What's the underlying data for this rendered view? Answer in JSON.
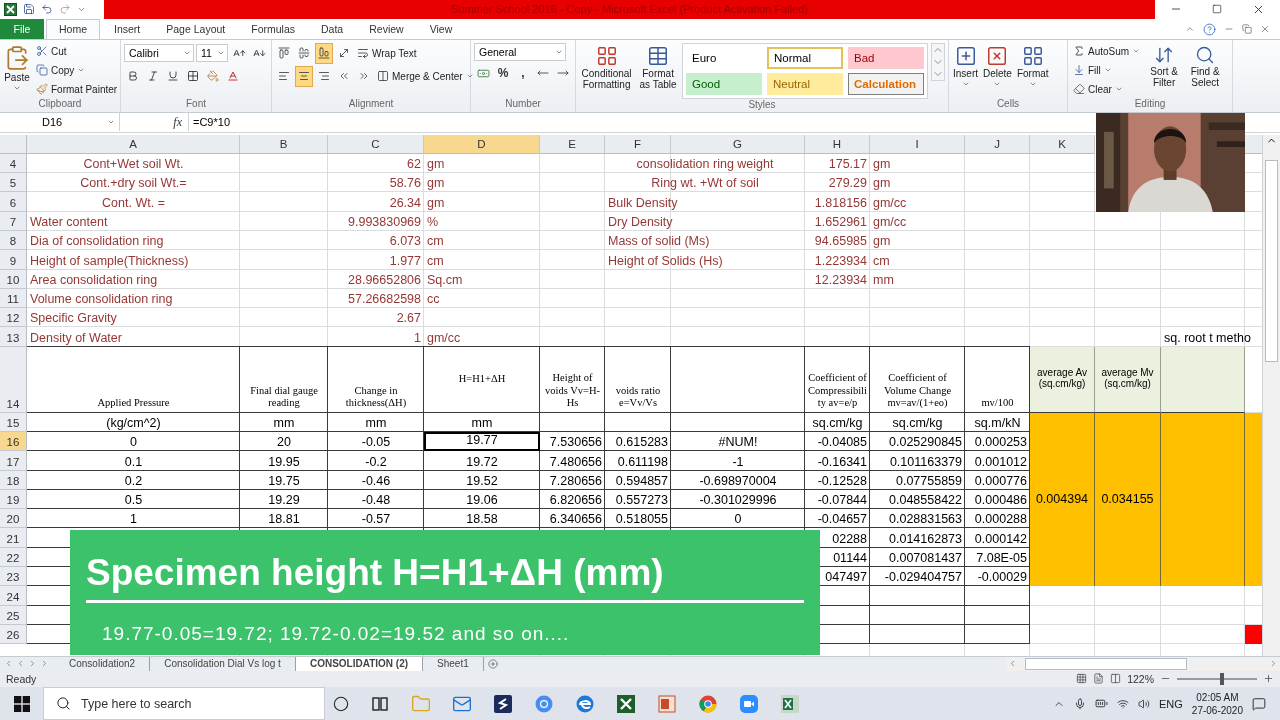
{
  "title": "Summer School 2016 - Copy - Microsoft Excel (Product Activation Failed)",
  "menu_tabs": [
    {
      "label": "File",
      "kind": "file",
      "selected": false
    },
    {
      "label": "Home",
      "kind": "tab",
      "selected": true
    },
    {
      "label": "Insert",
      "kind": "tab",
      "selected": false
    },
    {
      "label": "Page Layout",
      "kind": "tab",
      "selected": false
    },
    {
      "label": "Formulas",
      "kind": "tab",
      "selected": false
    },
    {
      "label": "Data",
      "kind": "tab",
      "selected": false
    },
    {
      "label": "Review",
      "kind": "tab",
      "selected": false
    },
    {
      "label": "View",
      "kind": "tab",
      "selected": false
    }
  ],
  "ribbon": {
    "clipboard": {
      "label": "Clipboard",
      "paste": "Paste",
      "cut": "Cut",
      "copy": "Copy",
      "format_painter": "Format Painter"
    },
    "font": {
      "label": "Font",
      "name": "Calibri",
      "size": "11"
    },
    "alignment": {
      "label": "Alignment",
      "vertical": [
        {
          "on": false
        },
        {
          "on": false
        },
        {
          "on": true
        }
      ],
      "horizontal": [
        {
          "on": false
        },
        {
          "on": true
        },
        {
          "on": false
        }
      ],
      "wrap_text": "Wrap Text",
      "merge_center": "Merge & Center"
    },
    "number": {
      "label": "Number",
      "format": "General",
      "percent": "%",
      "comma": ","
    },
    "styles": {
      "label": "Styles",
      "conditional": "Conditional Formatting",
      "format_table": "Format as Table",
      "gallery": [
        {
          "label": "Euro",
          "kind": "plain",
          "selected": false
        },
        {
          "label": "Normal",
          "kind": "plain",
          "selected": true
        },
        {
          "label": "Bad",
          "kind": "bad",
          "selected": false
        },
        {
          "label": "Good",
          "kind": "good",
          "selected": false
        },
        {
          "label": "Neutral",
          "kind": "neutral",
          "selected": false
        },
        {
          "label": "Calculation",
          "kind": "calculation",
          "selected": false
        }
      ]
    },
    "cells": {
      "label": "Cells",
      "insert": "Insert",
      "delete": "Delete",
      "format": "Format"
    },
    "editing": {
      "label": "Editing",
      "autosum": "AutoSum",
      "fill": "Fill",
      "clear": "Clear",
      "sort_filter": "Sort & Filter",
      "find_select": "Find & Select"
    }
  },
  "formula_bar": {
    "name_box": "D16",
    "fx": "fx",
    "formula": "=C9*10"
  },
  "sheet": {
    "columns": [
      {
        "label": "A",
        "selected": false
      },
      {
        "label": "B",
        "selected": false
      },
      {
        "label": "C",
        "selected": false
      },
      {
        "label": "D",
        "selected": true
      },
      {
        "label": "E",
        "selected": false
      },
      {
        "label": "F",
        "selected": false
      },
      {
        "label": "G",
        "selected": false
      },
      {
        "label": "H",
        "selected": false
      },
      {
        "label": "I",
        "selected": false
      },
      {
        "label": "J",
        "selected": false
      },
      {
        "label": "K",
        "selected": false
      }
    ],
    "rows": [
      {
        "label": "4",
        "kind": "normal",
        "selected": false,
        "cells": {
          "A": {
            "kind": "center",
            "text": "Cont+Wet soil Wt.",
            "selected": false
          },
          "C": {
            "kind": "value",
            "text": "62",
            "selected": false
          },
          "D": {
            "kind": "unit",
            "text": "gm",
            "selected": false
          },
          "F": {
            "kind": "wide-center",
            "text": "consolidation ring weight",
            "selected": false
          },
          "H": {
            "kind": "value",
            "text": "175.17",
            "selected": false
          },
          "I": {
            "kind": "unit",
            "text": "gm",
            "selected": false
          }
        }
      },
      {
        "label": "5",
        "kind": "normal",
        "selected": false,
        "cells": {
          "A": {
            "kind": "center",
            "text": "Cont.+dry soil Wt.=",
            "selected": false
          },
          "C": {
            "kind": "value",
            "text": "58.76",
            "selected": false
          },
          "D": {
            "kind": "unit",
            "text": "gm",
            "selected": false
          },
          "F": {
            "kind": "wide-center",
            "text": "Ring wt. +Wt of soil",
            "selected": false
          },
          "H": {
            "kind": "value",
            "text": "279.29",
            "selected": false
          },
          "I": {
            "kind": "unit",
            "text": "gm",
            "selected": false
          }
        }
      },
      {
        "label": "6",
        "kind": "normal",
        "selected": false,
        "cells": {
          "A": {
            "kind": "center",
            "text": "Cont. Wt. =",
            "selected": false
          },
          "C": {
            "kind": "value",
            "text": "26.34",
            "selected": false
          },
          "D": {
            "kind": "unit",
            "text": "gm",
            "selected": false
          },
          "F": {
            "kind": "wide-label",
            "text": "Bulk Density",
            "selected": false
          },
          "H": {
            "kind": "value",
            "text": "1.818156",
            "selected": false
          },
          "I": {
            "kind": "unit",
            "text": "gm/cc",
            "selected": false
          }
        }
      },
      {
        "label": "7",
        "kind": "normal",
        "selected": false,
        "cells": {
          "A": {
            "kind": "label",
            "text": "Water content",
            "selected": false
          },
          "C": {
            "kind": "value",
            "text": "9.993830969",
            "selected": false
          },
          "D": {
            "kind": "unit",
            "text": "%",
            "selected": false
          },
          "F": {
            "kind": "wide-label",
            "text": "Dry Density",
            "selected": false
          },
          "H": {
            "kind": "value",
            "text": "1.652961",
            "selected": false
          },
          "I": {
            "kind": "unit",
            "text": "gm/cc",
            "selected": false
          }
        }
      },
      {
        "label": "8",
        "kind": "normal",
        "selected": false,
        "cells": {
          "A": {
            "kind": "label",
            "text": "Dia of consolidation ring",
            "selected": false
          },
          "C": {
            "kind": "value",
            "text": "6.073",
            "selected": false
          },
          "D": {
            "kind": "unit",
            "text": "cm",
            "selected": false
          },
          "F": {
            "kind": "wide-label",
            "text": "Mass of solid (Ms)",
            "selected": false
          },
          "H": {
            "kind": "value",
            "text": "94.65985",
            "selected": false
          },
          "I": {
            "kind": "unit",
            "text": "gm",
            "selected": false
          }
        }
      },
      {
        "label": "9",
        "kind": "normal",
        "selected": false,
        "cells": {
          "A": {
            "kind": "label",
            "text": "Height of sample(Thickness)",
            "selected": false
          },
          "C": {
            "kind": "value",
            "text": "1.977",
            "selected": false
          },
          "D": {
            "kind": "unit",
            "text": "cm",
            "selected": false
          },
          "F": {
            "kind": "wide-label",
            "text": "Height of Solids (Hs)",
            "selected": false
          },
          "H": {
            "kind": "value",
            "text": "1.223934",
            "selected": false
          },
          "I": {
            "kind": "unit",
            "text": "cm",
            "selected": false
          }
        }
      },
      {
        "label": "10",
        "kind": "normal",
        "selected": false,
        "cells": {
          "A": {
            "kind": "label",
            "text": "Area consolidation ring",
            "selected": false
          },
          "C": {
            "kind": "value",
            "text": "28.96652806",
            "selected": false
          },
          "D": {
            "kind": "unit",
            "text": "Sq.cm",
            "selected": false
          },
          "H": {
            "kind": "value",
            "text": "12.23934",
            "selected": false
          },
          "I": {
            "kind": "unit",
            "text": "mm",
            "selected": false
          }
        }
      },
      {
        "label": "11",
        "kind": "normal",
        "selected": false,
        "cells": {
          "A": {
            "kind": "label",
            "text": "Volume consolidation ring",
            "selected": false
          },
          "C": {
            "kind": "value",
            "text": "57.26682598",
            "selected": false
          },
          "D": {
            "kind": "unit",
            "text": "cc",
            "selected": false
          }
        }
      },
      {
        "label": "12",
        "kind": "normal",
        "selected": false,
        "cells": {
          "A": {
            "kind": "label",
            "text": "Specific Gravity",
            "selected": false
          },
          "C": {
            "kind": "value",
            "text": "2.67",
            "selected": false
          }
        }
      },
      {
        "label": "13",
        "kind": "normal",
        "selected": false,
        "cells": {
          "A": {
            "kind": "label",
            "text": "Density of Water",
            "selected": false
          },
          "C": {
            "kind": "value",
            "text": "1",
            "selected": false
          },
          "D": {
            "kind": "unit",
            "text": "gm/cc",
            "selected": false
          },
          "M": {
            "kind": "wide-note",
            "text": "sq. root t metho",
            "selected": false
          }
        }
      },
      {
        "label": "14",
        "kind": "header",
        "selected": false,
        "cells": {
          "A": {
            "kind": "head",
            "text": "Applied Pressure",
            "selected": false
          },
          "B": {
            "kind": "head",
            "text": "Final dial gauge reading",
            "selected": false
          },
          "C": {
            "kind": "head",
            "text": "Change in thickness(ΔH)",
            "selected": false
          },
          "D": {
            "kind": "head-middle",
            "text": "H=H1+ΔH",
            "selected": false
          },
          "E": {
            "kind": "head",
            "text": "Height of voids Vv=H-Hs",
            "selected": false
          },
          "F": {
            "kind": "head",
            "text": "voids ratio e=Vv/Vs",
            "selected": false
          },
          "H": {
            "kind": "head",
            "text": "Coefficient of Compressibility av=e/p",
            "selected": false
          },
          "I": {
            "kind": "head",
            "text": "Coefficient of Volume Change mv=av/(1+eo)",
            "selected": false
          },
          "J": {
            "kind": "head",
            "text": "mv/100",
            "selected": false
          },
          "K": {
            "kind": "head-green",
            "text": "average Av (sq.cm/kg)",
            "selected": false
          },
          "L": {
            "kind": "head-green",
            "text": "average Mv (sq.cm/kg)",
            "selected": false
          },
          "M": {
            "kind": "green",
            "selected": false
          }
        }
      },
      {
        "label": "15",
        "kind": "normal",
        "selected": false,
        "cells": {
          "A": {
            "kind": "data",
            "text": "(kg/cm^2)",
            "selected": false
          },
          "B": {
            "kind": "data",
            "text": "mm",
            "selected": false
          },
          "C": {
            "kind": "data",
            "text": "mm",
            "selected": false
          },
          "D": {
            "kind": "data",
            "text": "mm",
            "selected": false
          },
          "H": {
            "kind": "data",
            "text": "sq.cm/kg",
            "selected": false
          },
          "I": {
            "kind": "data",
            "text": "sq.cm/kg",
            "selected": false
          },
          "J": {
            "kind": "data",
            "text": "sq.m/kN",
            "selected": false
          },
          "K": {
            "kind": "average",
            "text": "0.004394",
            "selected": false
          },
          "L": {
            "kind": "average",
            "text": "0.034155",
            "selected": false
          },
          "M": {
            "kind": "fill",
            "selected": false
          },
          "N": {
            "kind": "fill",
            "selected": false
          }
        }
      },
      {
        "label": "16",
        "kind": "normal",
        "selected": true,
        "cells": {
          "A": {
            "kind": "data",
            "text": "0",
            "selected": false
          },
          "B": {
            "kind": "data",
            "text": "20",
            "selected": false
          },
          "C": {
            "kind": "data",
            "text": "-0.05",
            "selected": false
          },
          "D": {
            "kind": "data",
            "text": "19.77",
            "selected": true
          },
          "E": {
            "kind": "num",
            "text": "7.530656",
            "selected": false
          },
          "F": {
            "kind": "num",
            "text": "0.615283",
            "selected": false
          },
          "G": {
            "kind": "data",
            "text": "#NUM!",
            "selected": false
          },
          "H": {
            "kind": "num",
            "text": "-0.04085",
            "selected": false
          },
          "I": {
            "kind": "num",
            "text": "0.025290845",
            "selected": false
          },
          "J": {
            "kind": "num",
            "text": "0.000253",
            "selected": false
          }
        }
      },
      {
        "label": "17",
        "kind": "normal",
        "selected": false,
        "cells": {
          "A": {
            "kind": "data",
            "text": "0.1",
            "selected": false
          },
          "B": {
            "kind": "data",
            "text": "19.95",
            "selected": false
          },
          "C": {
            "kind": "data",
            "text": "-0.2",
            "selected": false
          },
          "D": {
            "kind": "data",
            "text": "19.72",
            "selected": false
          },
          "E": {
            "kind": "num",
            "text": "7.480656",
            "selected": false
          },
          "F": {
            "kind": "num",
            "text": "0.611198",
            "selected": false
          },
          "G": {
            "kind": "data",
            "text": "-1",
            "selected": false
          },
          "H": {
            "kind": "num",
            "text": "-0.16341",
            "selected": false
          },
          "I": {
            "kind": "num",
            "text": "0.101163379",
            "selected": false
          },
          "J": {
            "kind": "num",
            "text": "0.001012",
            "selected": false
          }
        }
      },
      {
        "label": "18",
        "kind": "normal",
        "selected": false,
        "cells": {
          "A": {
            "kind": "data",
            "text": "0.2",
            "selected": false
          },
          "B": {
            "kind": "data",
            "text": "19.75",
            "selected": false
          },
          "C": {
            "kind": "data",
            "text": "-0.46",
            "selected": false
          },
          "D": {
            "kind": "data",
            "text": "19.52",
            "selected": false
          },
          "E": {
            "kind": "num",
            "text": "7.280656",
            "selected": false
          },
          "F": {
            "kind": "num",
            "text": "0.594857",
            "selected": false
          },
          "G": {
            "kind": "data",
            "text": "-0.698970004",
            "selected": false
          },
          "H": {
            "kind": "num",
            "text": "-0.12528",
            "selected": false
          },
          "I": {
            "kind": "num",
            "text": "0.07755859",
            "selected": false
          },
          "J": {
            "kind": "num",
            "text": "0.000776",
            "selected": false
          }
        }
      },
      {
        "label": "19",
        "kind": "normal",
        "selected": false,
        "cells": {
          "A": {
            "kind": "data",
            "text": "0.5",
            "selected": false
          },
          "B": {
            "kind": "data",
            "text": "19.29",
            "selected": false
          },
          "C": {
            "kind": "data",
            "text": "-0.48",
            "selected": false
          },
          "D": {
            "kind": "data",
            "text": "19.06",
            "selected": false
          },
          "E": {
            "kind": "num",
            "text": "6.820656",
            "selected": false
          },
          "F": {
            "kind": "num",
            "text": "0.557273",
            "selected": false
          },
          "G": {
            "kind": "data",
            "text": "-0.301029996",
            "selected": false
          },
          "H": {
            "kind": "num",
            "text": "-0.07844",
            "selected": false
          },
          "I": {
            "kind": "num",
            "text": "0.048558422",
            "selected": false
          },
          "J": {
            "kind": "num",
            "text": "0.000486",
            "selected": false
          }
        }
      },
      {
        "label": "20",
        "kind": "normal",
        "selected": false,
        "cells": {
          "A": {
            "kind": "data",
            "text": "1",
            "selected": false
          },
          "B": {
            "kind": "data",
            "text": "18.81",
            "selected": false
          },
          "C": {
            "kind": "data",
            "text": "-0.57",
            "selected": false
          },
          "D": {
            "kind": "data",
            "text": "18.58",
            "selected": false
          },
          "E": {
            "kind": "num",
            "text": "6.340656",
            "selected": false
          },
          "F": {
            "kind": "num",
            "text": "0.518055",
            "selected": false
          },
          "G": {
            "kind": "data",
            "text": "0",
            "selected": false
          },
          "H": {
            "kind": "num",
            "text": "-0.04657",
            "selected": false
          },
          "I": {
            "kind": "num",
            "text": "0.028831563",
            "selected": false
          },
          "J": {
            "kind": "num",
            "text": "0.000288",
            "selected": false
          }
        }
      },
      {
        "label": "21",
        "kind": "normal",
        "selected": false,
        "cells": {
          "H": {
            "kind": "num",
            "text": "02288",
            "selected": false
          },
          "I": {
            "kind": "num",
            "text": "0.014162873",
            "selected": false
          },
          "J": {
            "kind": "num",
            "text": "0.000142",
            "selected": false
          }
        }
      },
      {
        "label": "22",
        "kind": "normal",
        "selected": false,
        "cells": {
          "H": {
            "kind": "num",
            "text": "01144",
            "selected": false
          },
          "I": {
            "kind": "num",
            "text": "0.007081437",
            "selected": false
          },
          "J": {
            "kind": "num",
            "text": "7.08E-05",
            "selected": false
          }
        }
      },
      {
        "label": "23",
        "kind": "normal",
        "selected": false,
        "cells": {
          "H": {
            "kind": "num",
            "text": "047497",
            "selected": false
          },
          "I": {
            "kind": "num",
            "text": "-0.029404757",
            "selected": false
          },
          "J": {
            "kind": "num",
            "text": "-0.00029",
            "selected": false
          }
        }
      },
      {
        "label": "24",
        "kind": "normal",
        "selected": false
      },
      {
        "label": "25",
        "kind": "normal",
        "selected": false
      },
      {
        "label": "26",
        "kind": "normal",
        "selected": false,
        "cells": {
          "N": {
            "kind": "alert",
            "selected": false
          }
        }
      }
    ]
  },
  "banner": {
    "title": "Specimen height H=H1+ΔH (mm)",
    "caption": "19.77-0.05=19.72; 19.72-0.02=19.52 and so on...."
  },
  "sheet_tabs": [
    {
      "label": "Consolidation2",
      "selected": false
    },
    {
      "label": "Consolidation Dial Vs log t",
      "selected": false
    },
    {
      "label": "CONSOLIDATION (2)",
      "selected": true
    },
    {
      "label": "Sheet1",
      "selected": false
    }
  ],
  "status_bar": {
    "status": "Ready",
    "zoom": "122%",
    "zoom_slider": {
      "level": 0.56
    }
  },
  "taskbar": {
    "search": {
      "placeholder": "Type here to search"
    },
    "language": "ENG",
    "time": "02:05 AM",
    "date": "27-06-2020"
  }
}
